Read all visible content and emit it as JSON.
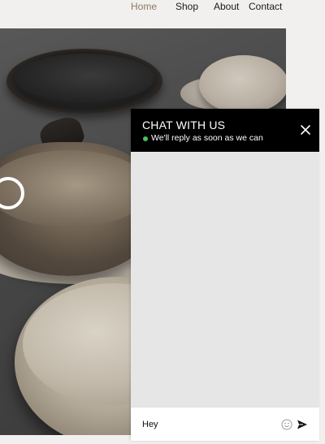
{
  "nav": {
    "items": [
      {
        "label": "Home",
        "active": true
      },
      {
        "label": "Shop",
        "active": false
      },
      {
        "label": "About",
        "active": false
      },
      {
        "label": "Contact",
        "active": false
      }
    ],
    "active_color": "#8d7a5e"
  },
  "hero": {
    "image": "ceramic-bowls-and-plates-photo"
  },
  "chat": {
    "title": "CHAT WITH US",
    "status_text": "We'll reply as soon as we can",
    "status_color": "#4cc15a",
    "close_icon": "close-icon",
    "input_value": "Hey",
    "emoji_icon": "emoji-icon",
    "send_icon": "send-icon",
    "header_color": "#000000"
  }
}
